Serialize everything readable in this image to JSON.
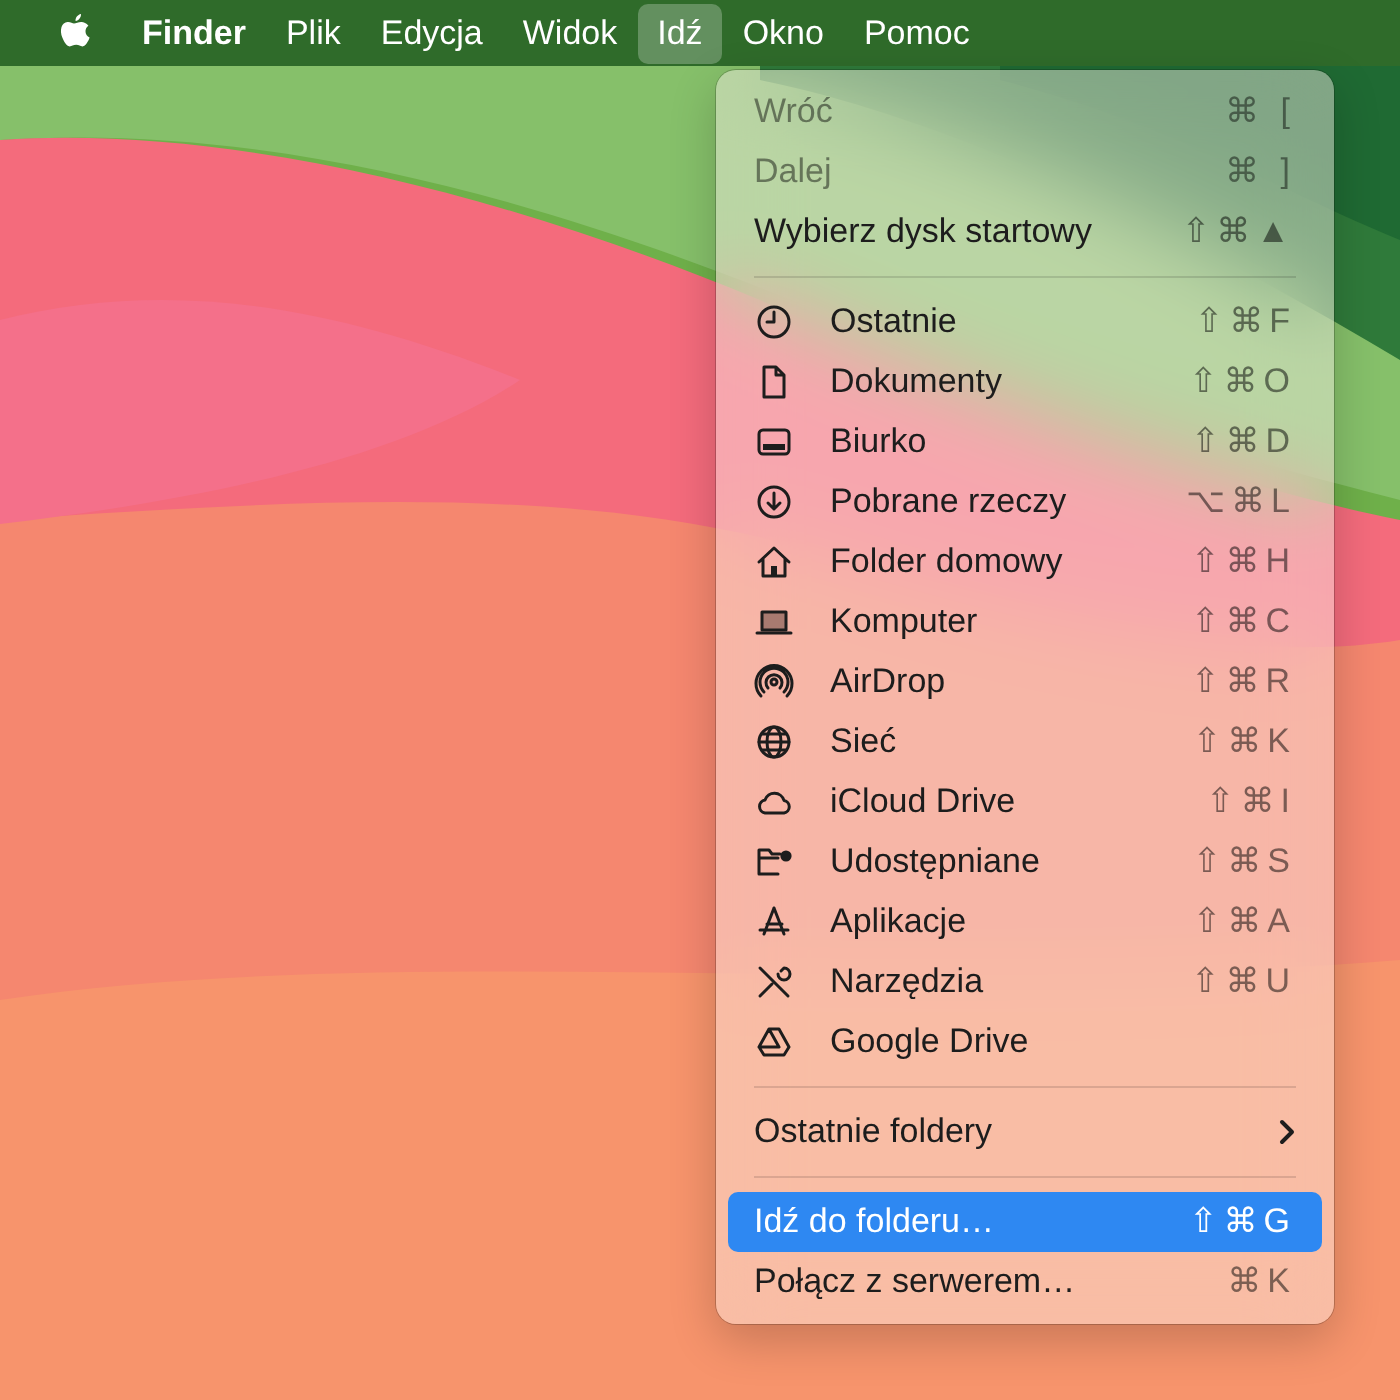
{
  "menu_bar": {
    "items": [
      {
        "label": "Finder",
        "kind": "app",
        "selected": false
      },
      {
        "label": "Plik",
        "kind": "menu",
        "selected": false
      },
      {
        "label": "Edycja",
        "kind": "menu",
        "selected": false
      },
      {
        "label": "Widok",
        "kind": "menu",
        "selected": false
      },
      {
        "label": "Idź",
        "kind": "menu",
        "selected": true
      },
      {
        "label": "Okno",
        "kind": "menu",
        "selected": false
      },
      {
        "label": "Pomoc",
        "kind": "menu",
        "selected": false
      }
    ]
  },
  "menu": {
    "items": [
      {
        "kind": "item",
        "label": "Wróć",
        "shortcut": "⌘ [",
        "disabled": true,
        "selected": false
      },
      {
        "kind": "item",
        "label": "Dalej",
        "shortcut": "⌘ ]",
        "disabled": true,
        "selected": false
      },
      {
        "kind": "item",
        "label": "Wybierz dysk startowy",
        "shortcut": "⇧⌘▲",
        "disabled": false,
        "selected": false
      },
      {
        "kind": "separator"
      },
      {
        "kind": "place",
        "label": "Ostatnie",
        "shortcut": "⇧⌘F",
        "disabled": false,
        "selected": false
      },
      {
        "kind": "place",
        "label": "Dokumenty",
        "shortcut": "⇧⌘O",
        "disabled": false,
        "selected": false
      },
      {
        "kind": "place",
        "label": "Biurko",
        "shortcut": "⇧⌘D",
        "disabled": false,
        "selected": false
      },
      {
        "kind": "place",
        "label": "Pobrane rzeczy",
        "shortcut": "⌥⌘L",
        "disabled": false,
        "selected": false
      },
      {
        "kind": "place",
        "label": "Folder domowy",
        "shortcut": "⇧⌘H",
        "disabled": false,
        "selected": false
      },
      {
        "kind": "place",
        "label": "Komputer",
        "shortcut": "⇧⌘C",
        "disabled": false,
        "selected": false
      },
      {
        "kind": "place",
        "label": "AirDrop",
        "shortcut": "⇧⌘R",
        "disabled": false,
        "selected": false
      },
      {
        "kind": "place",
        "label": "Sieć",
        "shortcut": "⇧⌘K",
        "disabled": false,
        "selected": false
      },
      {
        "kind": "place",
        "label": "iCloud Drive",
        "shortcut": "⇧⌘I",
        "disabled": false,
        "selected": false
      },
      {
        "kind": "place",
        "label": "Udostępniane",
        "shortcut": "⇧⌘S",
        "disabled": false,
        "selected": false
      },
      {
        "kind": "place",
        "label": "Aplikacje",
        "shortcut": "⇧⌘A",
        "disabled": false,
        "selected": false
      },
      {
        "kind": "place",
        "label": "Narzędzia",
        "shortcut": "⇧⌘U",
        "disabled": false,
        "selected": false
      },
      {
        "kind": "place",
        "label": "Google Drive",
        "disabled": false,
        "selected": false
      },
      {
        "kind": "separator"
      },
      {
        "kind": "submenu",
        "label": "Ostatnie foldery",
        "disabled": false,
        "selected": false
      },
      {
        "kind": "separator"
      },
      {
        "kind": "item",
        "label": "Idź do folderu…",
        "shortcut": "⇧⌘G",
        "disabled": false,
        "selected": true
      },
      {
        "kind": "item",
        "label": "Połącz z serwerem…",
        "shortcut": "⌘K",
        "disabled": false,
        "selected": false
      }
    ]
  }
}
